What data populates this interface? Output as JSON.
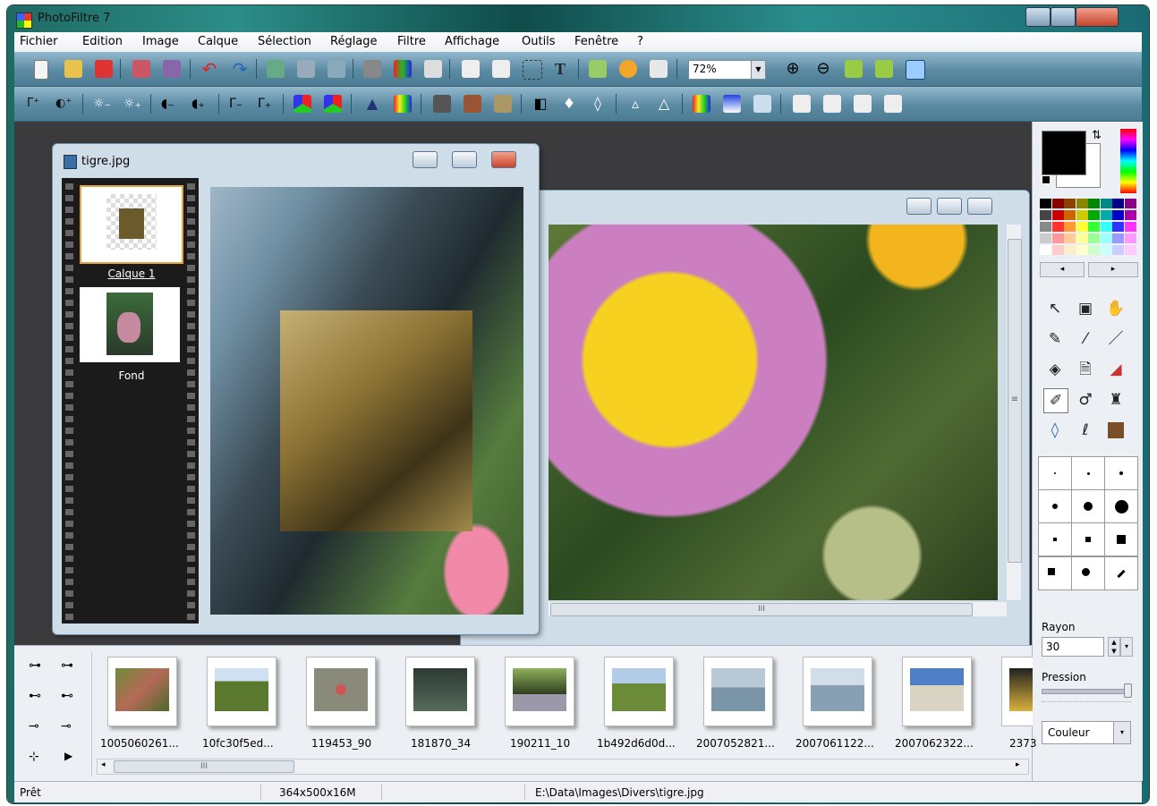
{
  "window": {
    "title": "PhotoFiltre 7"
  },
  "menu": [
    "Fichier",
    "Edition",
    "Image",
    "Calque",
    "Sélection",
    "Réglage",
    "Filtre",
    "Affichage",
    "Outils",
    "Fenêtre",
    "?"
  ],
  "toolbar": {
    "zoom": "72%"
  },
  "doc_tigre": {
    "title": "tigre.jpg",
    "layers": [
      {
        "label": "Calque 1"
      },
      {
        "label": "Fond"
      }
    ]
  },
  "right_panel": {
    "rayon_label": "Rayon",
    "rayon_value": "30",
    "pression_label": "Pression",
    "mode_value": "Couleur"
  },
  "bottom": {
    "thumbnails": [
      "1005060261...",
      "10fc30f5ed...",
      "119453_90",
      "181870_34",
      "190211_10",
      "1b492d6d0d...",
      "2007052821...",
      "2007061122...",
      "2007062322...",
      "2373"
    ],
    "h_scroll_grip": "III"
  },
  "doc_fleur": {
    "h_scroll_grip": "III",
    "v_scroll_grip": "≡"
  },
  "statusbar": {
    "state": "Prêt",
    "image_info": "364x500x16M",
    "path": "E:\\Data\\Images\\Divers\\tigre.jpg"
  },
  "colors": {
    "foreground": "#000000",
    "background": "#ffffff",
    "toolbar": "#5b8aa3"
  },
  "icons": [
    "new-icon",
    "open-icon",
    "save-icon",
    "print-icon",
    "undo-icon",
    "redo-icon",
    "text-icon",
    "zoom-in-icon",
    "zoom-out-icon",
    "pointer-icon",
    "hand-icon",
    "eyedropper-icon",
    "magic-wand-icon",
    "line-icon",
    "fill-icon",
    "spray-icon",
    "eraser-icon",
    "brush-icon",
    "smudge-icon",
    "stamp-icon",
    "blur-drop-icon",
    "finger-icon",
    "portrait-icon"
  ]
}
